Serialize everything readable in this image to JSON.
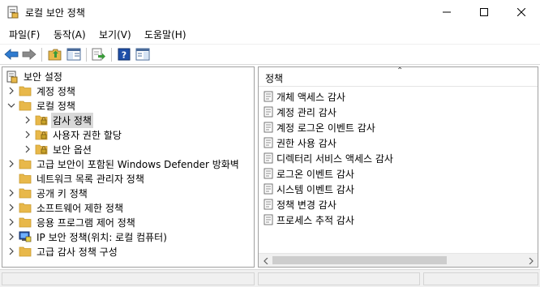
{
  "window": {
    "title": "로컬 보안 정책",
    "icons": {
      "app": "local-security-policy-icon",
      "minimize": "minimize-icon",
      "maximize": "maximize-icon",
      "close": "close-icon"
    }
  },
  "menu": [
    {
      "label": "파일(F)"
    },
    {
      "label": "동작(A)"
    },
    {
      "label": "보기(V)"
    },
    {
      "label": "도움말(H)"
    }
  ],
  "toolbar": {
    "buttons": [
      "back-arrow-icon",
      "forward-arrow-icon",
      "up-folder-icon",
      "show-hide-tree-icon",
      "export-list-icon",
      "help-icon",
      "properties-pane-icon"
    ]
  },
  "tree": {
    "root": {
      "label": "보안 설정"
    },
    "items": [
      {
        "label": "계정 정책",
        "level": 1,
        "expanded": false
      },
      {
        "label": "로컬 정책",
        "level": 1,
        "expanded": true
      },
      {
        "label": "감사 정책",
        "level": 2,
        "expanded": false,
        "selected": true
      },
      {
        "label": "사용자 권한 할당",
        "level": 2,
        "expanded": false
      },
      {
        "label": "보안 옵션",
        "level": 2,
        "expanded": false
      },
      {
        "label": "고급 보안이 포함된 Windows Defender 방화벽",
        "level": 1,
        "expanded": false
      },
      {
        "label": "네트워크 목록 관리자 정책",
        "level": 1,
        "expanded": null
      },
      {
        "label": "공개 키 정책",
        "level": 1,
        "expanded": false
      },
      {
        "label": "소프트웨어 제한 정책",
        "level": 1,
        "expanded": false
      },
      {
        "label": "응용 프로그램 제어 정책",
        "level": 1,
        "expanded": false
      },
      {
        "label": "IP 보안 정책(위치: 로컬 컴퓨터)",
        "level": 1,
        "expanded": false,
        "icon": "ip-security-icon"
      },
      {
        "label": "고급 감사 정책 구성",
        "level": 1,
        "expanded": false
      }
    ]
  },
  "list": {
    "column_header": "정책",
    "items": [
      {
        "label": "개체 액세스 감사"
      },
      {
        "label": "계정 관리 감사"
      },
      {
        "label": "계정 로그온 이벤트 감사"
      },
      {
        "label": "권한 사용 감사"
      },
      {
        "label": "디렉터리 서비스 액세스 감사"
      },
      {
        "label": "로그온 이벤트 감사"
      },
      {
        "label": "시스템 이벤트 감사"
      },
      {
        "label": "정책 변경 감사"
      },
      {
        "label": "프로세스 추적 감사"
      }
    ]
  },
  "colors": {
    "folder": "#e8b84a",
    "folder_dark": "#c99a2e",
    "selection": "#d9d9d9",
    "border": "#a0a0a0",
    "back_arrow": "#2f7bd0"
  }
}
